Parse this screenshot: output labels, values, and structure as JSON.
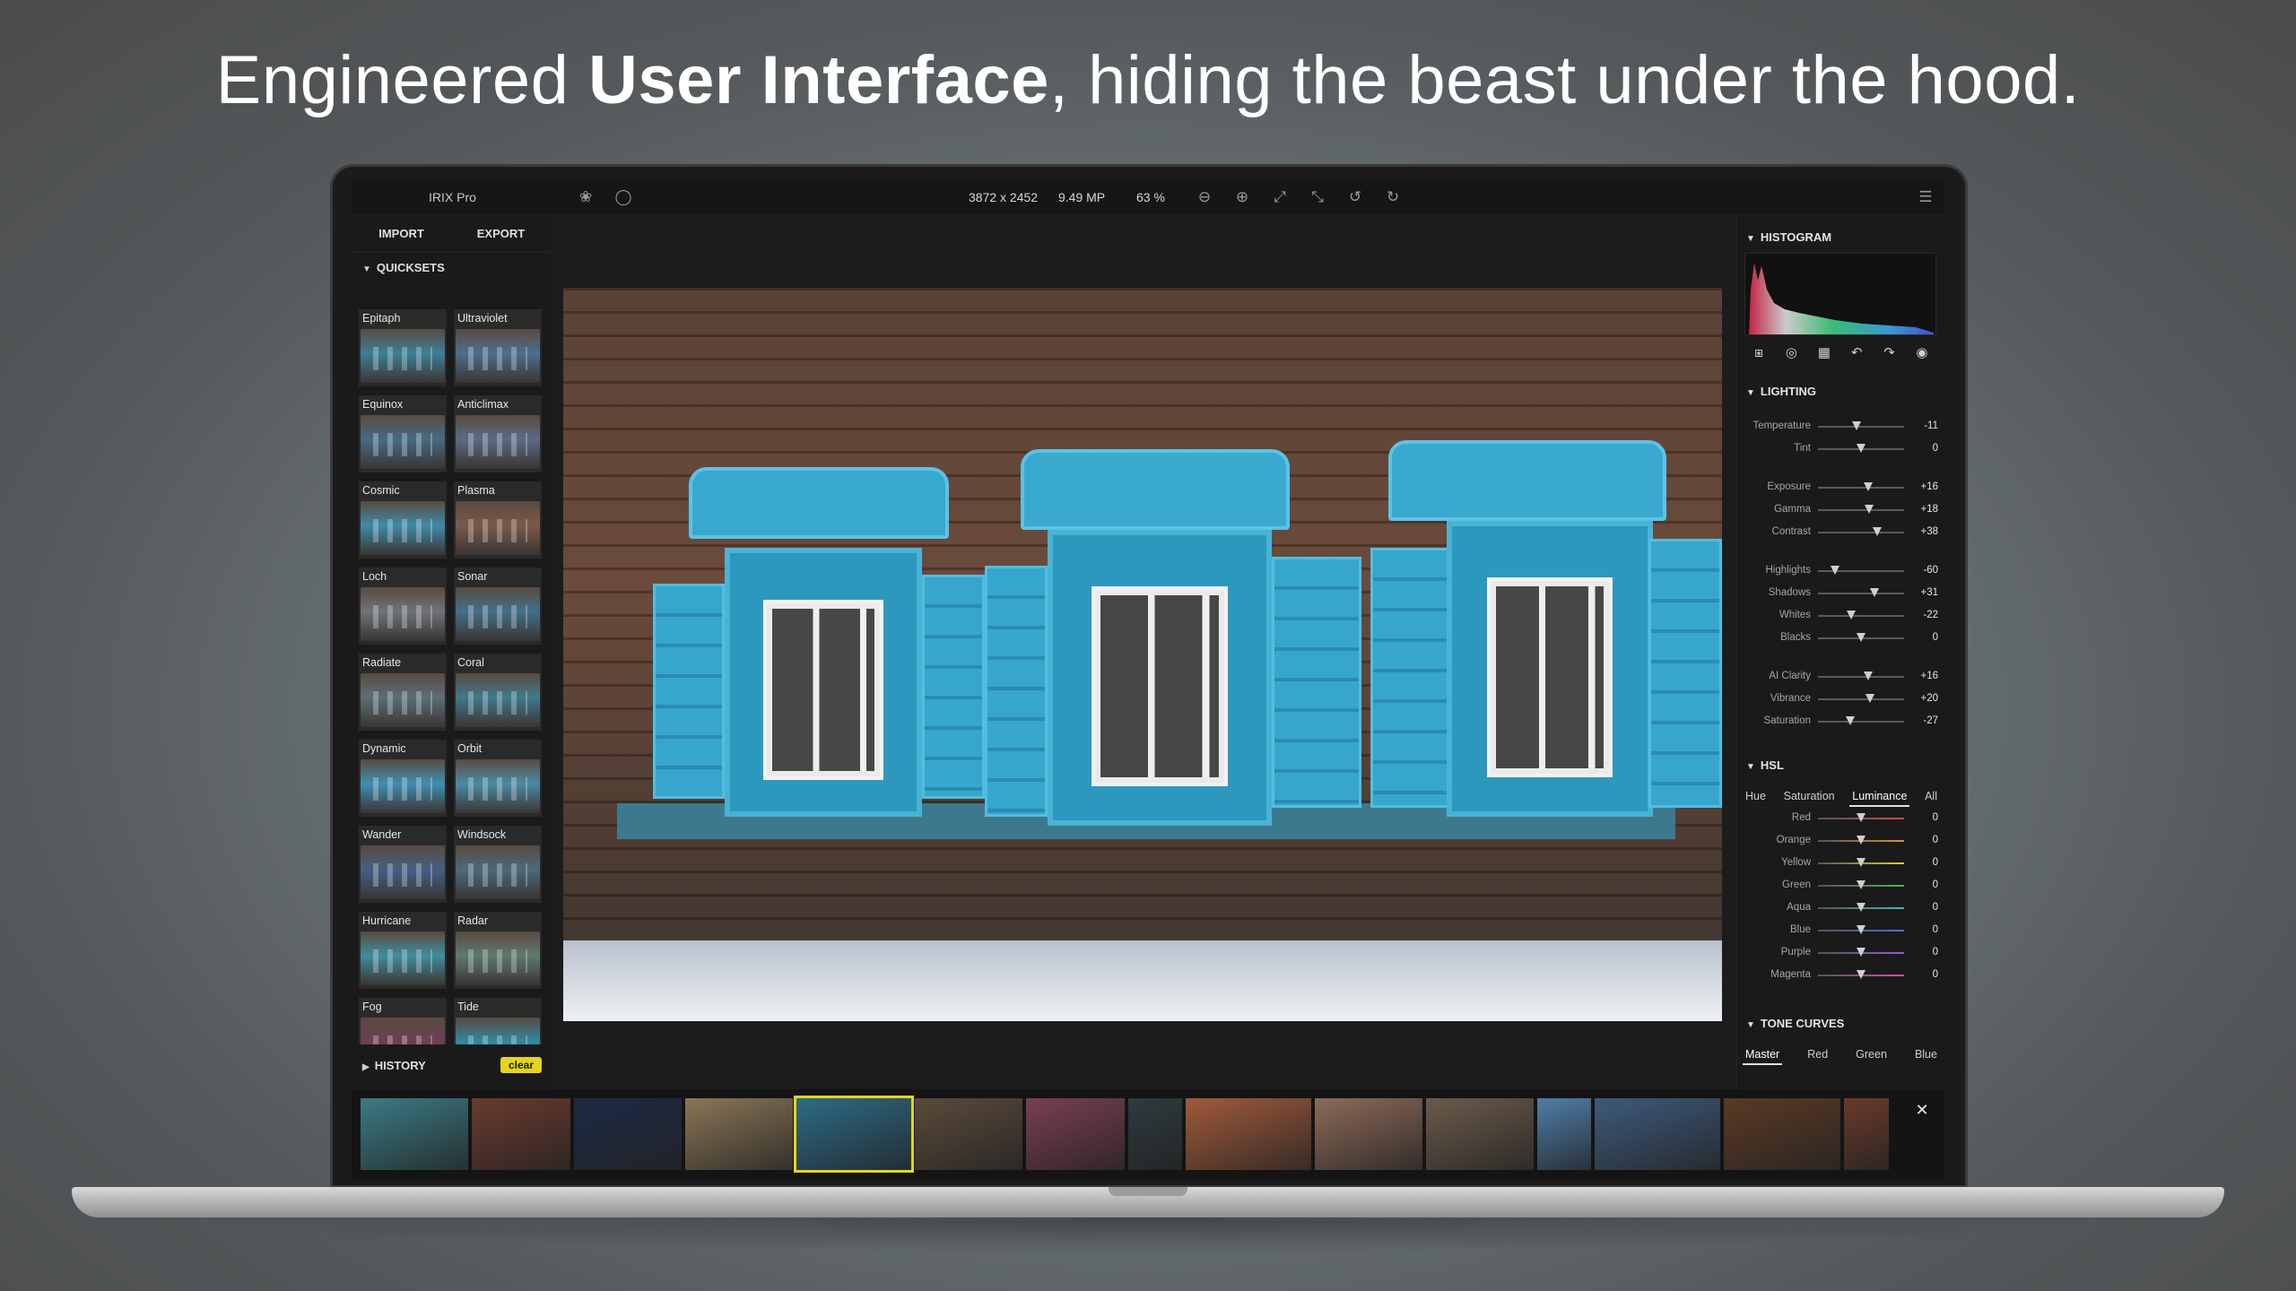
{
  "headline": {
    "part1": "Engineered ",
    "bold": "User Interface",
    "part2": ", hiding the beast under the hood."
  },
  "app": {
    "title": "IRIX Pro",
    "dimensions": "3872 x 2452",
    "megapixels": "9.49 MP",
    "zoom": "63 %"
  },
  "toolbar_icons": [
    "effects-icon",
    "compare-icon",
    "zoom-out-icon",
    "zoom-in-icon",
    "fit-screen-icon",
    "actual-size-icon",
    "rotate-left-icon",
    "rotate-right-icon",
    "menu-icon"
  ],
  "left": {
    "import_label": "IMPORT",
    "export_label": "EXPORT",
    "quicksets_label": "QUICKSETS",
    "history_label": "HISTORY",
    "clear_label": "clear",
    "quicksets": [
      {
        "name": "Epitaph",
        "tint": "#3d7f96"
      },
      {
        "name": "Ultraviolet",
        "tint": "#4c6f8e"
      },
      {
        "name": "Equinox",
        "tint": "#466b84"
      },
      {
        "name": "Anticlimax",
        "tint": "#5b6a86"
      },
      {
        "name": "Cosmic",
        "tint": "#3f8aa8"
      },
      {
        "name": "Plasma",
        "tint": "#7a5a4a"
      },
      {
        "name": "Loch",
        "tint": "#6f7378"
      },
      {
        "name": "Sonar",
        "tint": "#41708a"
      },
      {
        "name": "Radiate",
        "tint": "#5c6f76"
      },
      {
        "name": "Coral",
        "tint": "#3f7a8c"
      },
      {
        "name": "Dynamic",
        "tint": "#3f8fb0"
      },
      {
        "name": "Orbit",
        "tint": "#4b8aa6"
      },
      {
        "name": "Wander",
        "tint": "#445f86"
      },
      {
        "name": "Windsock",
        "tint": "#4a6a7c"
      },
      {
        "name": "Hurricane",
        "tint": "#3f8e9e"
      },
      {
        "name": "Radar",
        "tint": "#5d7a6e"
      },
      {
        "name": "Fog",
        "tint": "#6e3f54"
      },
      {
        "name": "Tide",
        "tint": "#2f8aa0"
      }
    ]
  },
  "right": {
    "histogram_label": "HISTOGRAM",
    "tool_icons": [
      "crop-icon",
      "spot-heal-icon",
      "mask-icon",
      "undo-icon",
      "redo-icon",
      "eye-icon"
    ],
    "lighting_label": "LIGHTING",
    "lighting": [
      {
        "label": "Temperature",
        "value": "-11",
        "pos": 0.45
      },
      {
        "label": "Tint",
        "value": "0",
        "pos": 0.5
      },
      {
        "label": "Exposure",
        "value": "+16",
        "pos": 0.58
      },
      {
        "label": "Gamma",
        "value": "+18",
        "pos": 0.59
      },
      {
        "label": "Contrast",
        "value": "+38",
        "pos": 0.69
      },
      {
        "label": "Highlights",
        "value": "-60",
        "pos": 0.2
      },
      {
        "label": "Shadows",
        "value": "+31",
        "pos": 0.66
      },
      {
        "label": "Whites",
        "value": "-22",
        "pos": 0.39
      },
      {
        "label": "Blacks",
        "value": "0",
        "pos": 0.5
      },
      {
        "label": "AI Clarity",
        "value": "+16",
        "pos": 0.58
      },
      {
        "label": "Vibrance",
        "value": "+20",
        "pos": 0.6
      },
      {
        "label": "Saturation",
        "value": "-27",
        "pos": 0.37
      }
    ],
    "hsl_label": "HSL",
    "hsl_tabs": [
      "Hue",
      "Saturation",
      "Luminance",
      "All"
    ],
    "hsl_active": 2,
    "hsl": [
      {
        "label": "Red",
        "value": "0",
        "color": "#d24a4a"
      },
      {
        "label": "Orange",
        "value": "0",
        "color": "#d9903e"
      },
      {
        "label": "Yellow",
        "value": "0",
        "color": "#d8cf3e"
      },
      {
        "label": "Green",
        "value": "0",
        "color": "#4fb24f"
      },
      {
        "label": "Aqua",
        "value": "0",
        "color": "#3fbcbc"
      },
      {
        "label": "Blue",
        "value": "0",
        "color": "#4a6fd8"
      },
      {
        "label": "Purple",
        "value": "0",
        "color": "#9a58d2"
      },
      {
        "label": "Magenta",
        "value": "0",
        "color": "#d24fb2"
      }
    ],
    "tone_curves_label": "TONE CURVES",
    "curve_tabs": [
      "Master",
      "Red",
      "Green",
      "Blue"
    ],
    "curve_active": 0
  },
  "filmstrip": [
    {
      "name": "wave",
      "color": "#3a7b83",
      "w": 120
    },
    {
      "name": "nixie-clock",
      "color": "#6a3a2e",
      "w": 110
    },
    {
      "name": "mountain-night",
      "color": "#1d2a45",
      "w": 120
    },
    {
      "name": "desert-ruins",
      "color": "#8a7656",
      "w": 120
    },
    {
      "name": "blue-windows",
      "color": "#2c6b86",
      "w": 128,
      "selected": true
    },
    {
      "name": "wooden-house",
      "color": "#5b4a3a",
      "w": 120
    },
    {
      "name": "graffiti",
      "color": "#7a3e52",
      "w": 110
    },
    {
      "name": "alley",
      "color": "#2e3a3e",
      "w": 60
    },
    {
      "name": "market",
      "color": "#a05a3a",
      "w": 140
    },
    {
      "name": "tapestry",
      "color": "#8c6a58",
      "w": 120
    },
    {
      "name": "tree-rocks",
      "color": "#6b5a4a",
      "w": 120
    },
    {
      "name": "camel",
      "color": "#4f7ea8",
      "w": 60
    },
    {
      "name": "lake-balloon",
      "color": "#3d5a7a",
      "w": 140
    },
    {
      "name": "cathedral",
      "color": "#5a3a24",
      "w": 130
    },
    {
      "name": "partial",
      "color": "#6a3a2a",
      "w": 50
    }
  ],
  "colors": {
    "accent": "#e8d41a",
    "panel": "#1a1a1b",
    "shutter": "#2d98bd"
  }
}
